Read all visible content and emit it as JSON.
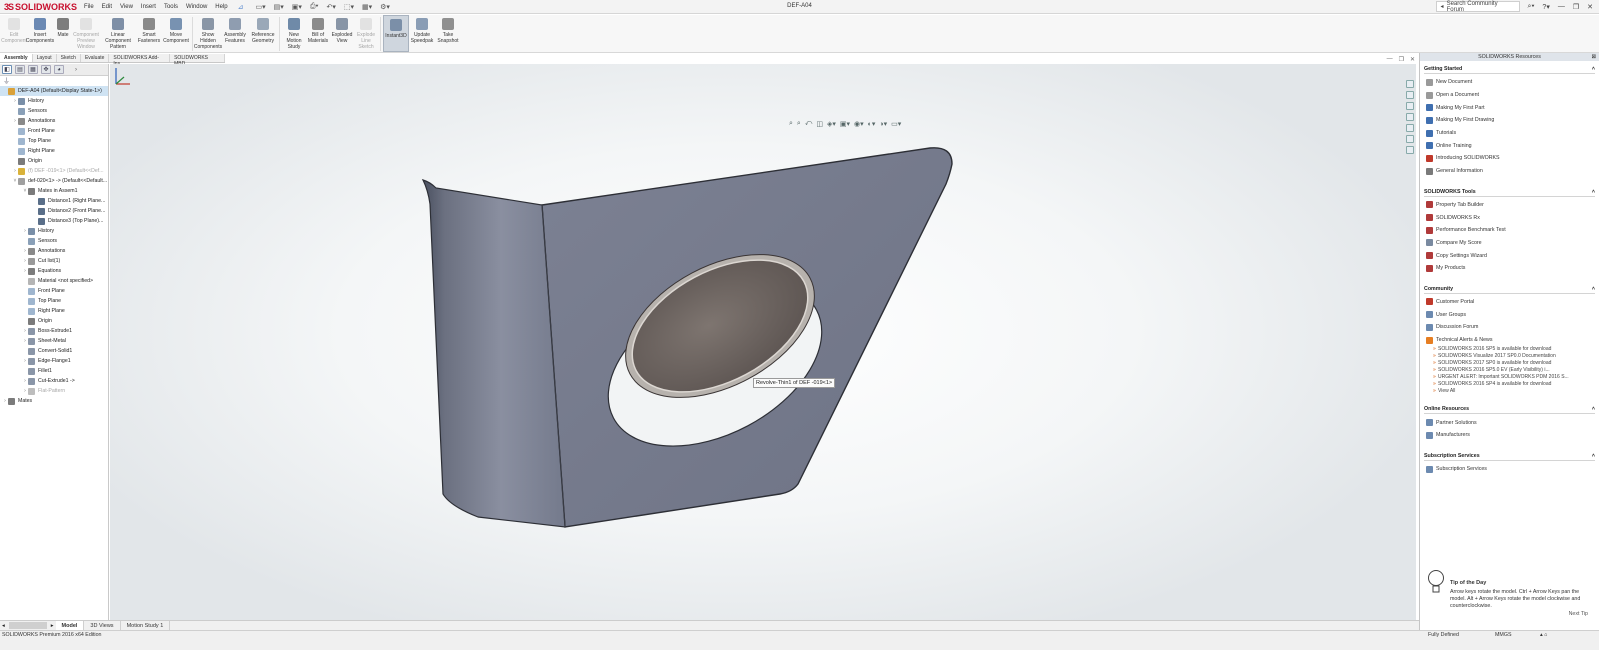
{
  "app": {
    "logo_text": "SOLIDWORKS",
    "document_title": "DEF-A04",
    "menus": [
      "File",
      "Edit",
      "View",
      "Insert",
      "Tools",
      "Window",
      "Help"
    ],
    "search_placeholder": "Search Community Forum"
  },
  "ribbon": {
    "buttons": [
      {
        "label": "Edit Component",
        "disabled": true,
        "icon": "edit-component-icon",
        "color": "#b9b9b9"
      },
      {
        "label": "Insert Components",
        "disabled": false,
        "icon": "insert-components-icon",
        "color": "#6b89b3"
      },
      {
        "label": "Mate",
        "disabled": false,
        "icon": "mate-icon",
        "color": "#7d7d7d"
      },
      {
        "label": "Component Preview Window",
        "disabled": true,
        "icon": "component-preview-icon",
        "color": "#b9b9b9"
      },
      {
        "label": "Linear Component Pattern",
        "disabled": false,
        "icon": "linear-pattern-icon",
        "color": "#7e8fa6"
      },
      {
        "label": "Smart Fasteners",
        "disabled": false,
        "icon": "smart-fasteners-icon",
        "color": "#8a8a8a"
      },
      {
        "label": "Move Component",
        "disabled": false,
        "icon": "move-component-icon",
        "color": "#7892b1"
      },
      {
        "label": "Show Hidden Components",
        "disabled": false,
        "icon": "show-hidden-icon",
        "color": "#8a96a6"
      },
      {
        "label": "Assembly Features",
        "disabled": false,
        "icon": "assembly-features-icon",
        "color": "#8f9db0"
      },
      {
        "label": "Reference Geometry",
        "disabled": false,
        "icon": "reference-geometry-icon",
        "color": "#9aa8b8"
      },
      {
        "label": "New Motion Study",
        "disabled": false,
        "icon": "motion-study-icon",
        "color": "#6f8aa8"
      },
      {
        "label": "Bill of Materials",
        "disabled": false,
        "icon": "bill-of-materials-icon",
        "color": "#8b8b8b"
      },
      {
        "label": "Exploded View",
        "disabled": false,
        "icon": "exploded-view-icon",
        "color": "#8895a6"
      },
      {
        "label": "Explode Line Sketch",
        "disabled": true,
        "icon": "explode-line-icon",
        "color": "#b9b9b9"
      },
      {
        "label": "Instant3D",
        "disabled": false,
        "active": true,
        "icon": "instant3d-icon",
        "color": "#7b8fa8"
      },
      {
        "label": "Update Speedpak",
        "disabled": false,
        "icon": "speedpak-icon",
        "color": "#8a9db5"
      },
      {
        "label": "Take Snapshot",
        "disabled": false,
        "icon": "snapshot-icon",
        "color": "#909090"
      }
    ]
  },
  "command_tabs": [
    "Assembly",
    "Layout",
    "Sketch",
    "Evaluate",
    "SOLIDWORKS Add-Ins",
    "SOLIDWORKS MBD"
  ],
  "tree": [
    {
      "label": "DEF-A04  (Default<Display State-1>)",
      "indent": 0,
      "sel": true,
      "icon": "assembly-icon",
      "color": "#d9a13a",
      "expander": ""
    },
    {
      "label": "History",
      "indent": 1,
      "icon": "history-icon",
      "color": "#7a8fa8",
      "expander": "›"
    },
    {
      "label": "Sensors",
      "indent": 1,
      "icon": "sensor-icon",
      "color": "#8aa0b8",
      "expander": ""
    },
    {
      "label": "Annotations",
      "indent": 1,
      "icon": "annotations-icon",
      "color": "#8a8a8a",
      "expander": "›"
    },
    {
      "label": "Front Plane",
      "indent": 1,
      "icon": "plane-icon",
      "color": "#9fb6cf",
      "expander": ""
    },
    {
      "label": "Top Plane",
      "indent": 1,
      "icon": "plane-icon",
      "color": "#9fb6cf",
      "expander": ""
    },
    {
      "label": "Right Plane",
      "indent": 1,
      "icon": "plane-icon",
      "color": "#9fb6cf",
      "expander": ""
    },
    {
      "label": "Origin",
      "indent": 1,
      "icon": "origin-icon",
      "color": "#7b7b7b",
      "expander": ""
    },
    {
      "label": "(f) DEF -019<1> (Default<<Def...",
      "indent": 1,
      "icon": "part-icon",
      "color": "#d9b23a",
      "expander": "›",
      "dim": true
    },
    {
      "label": "def-020<1> -> (Default<<Default...",
      "indent": 1,
      "icon": "part-icon",
      "color": "#a0a0a0",
      "expander": "˅"
    },
    {
      "label": "Mates in Assem1",
      "indent": 2,
      "icon": "mates-icon",
      "color": "#7b7b7b",
      "expander": "˅"
    },
    {
      "label": "Distance1 (Right Plane...",
      "indent": 3,
      "icon": "distance-mate-icon",
      "color": "#5a6f89",
      "expander": ""
    },
    {
      "label": "Distance2 (Front Plane...",
      "indent": 3,
      "icon": "distance-mate-icon",
      "color": "#5a6f89",
      "expander": ""
    },
    {
      "label": "Distance3 (Top Plane)...",
      "indent": 3,
      "icon": "distance-mate-icon",
      "color": "#5a6f89",
      "expander": ""
    },
    {
      "label": "History",
      "indent": 2,
      "icon": "history-icon",
      "color": "#7a8fa8",
      "expander": "›"
    },
    {
      "label": "Sensors",
      "indent": 2,
      "icon": "sensor-icon",
      "color": "#8aa0b8",
      "expander": ""
    },
    {
      "label": "Annotations",
      "indent": 2,
      "icon": "annotations-icon",
      "color": "#8a8a8a",
      "expander": "›"
    },
    {
      "label": "Cut list(1)",
      "indent": 2,
      "icon": "cut-list-icon",
      "color": "#9a9a9a",
      "expander": "›"
    },
    {
      "label": "Equations",
      "indent": 2,
      "icon": "equations-icon",
      "color": "#7d7d7d",
      "expander": "›"
    },
    {
      "label": "Material <not specified>",
      "indent": 2,
      "icon": "material-icon",
      "color": "#b5b5b5",
      "expander": ""
    },
    {
      "label": "Front Plane",
      "indent": 2,
      "icon": "plane-icon",
      "color": "#9fb6cf",
      "expander": ""
    },
    {
      "label": "Top Plane",
      "indent": 2,
      "icon": "plane-icon",
      "color": "#9fb6cf",
      "expander": ""
    },
    {
      "label": "Right Plane",
      "indent": 2,
      "icon": "plane-icon",
      "color": "#9fb6cf",
      "expander": ""
    },
    {
      "label": "Origin",
      "indent": 2,
      "icon": "origin-icon",
      "color": "#7b7b7b",
      "expander": ""
    },
    {
      "label": "Boss-Extrude1",
      "indent": 2,
      "icon": "extrude-icon",
      "color": "#8a96a8",
      "expander": "›"
    },
    {
      "label": "Sheet-Metal",
      "indent": 2,
      "icon": "sheet-metal-icon",
      "color": "#8a96a8",
      "expander": "›"
    },
    {
      "label": "Convert-Solid1",
      "indent": 2,
      "icon": "convert-solid-icon",
      "color": "#8a96a8",
      "expander": ""
    },
    {
      "label": "Edge-Flange1",
      "indent": 2,
      "icon": "edge-flange-icon",
      "color": "#8a96a8",
      "expander": "›"
    },
    {
      "label": "Fillet1",
      "indent": 2,
      "icon": "fillet-icon",
      "color": "#8a96a8",
      "expander": ""
    },
    {
      "label": "Cut-Extrude1 ->",
      "indent": 2,
      "icon": "cut-extrude-icon",
      "color": "#8a96a8",
      "expander": "›"
    },
    {
      "label": "Flat-Pattern",
      "indent": 2,
      "icon": "flat-pattern-icon",
      "color": "#bdbdbd",
      "expander": "›",
      "dim": true
    },
    {
      "label": "Mates",
      "indent": 0,
      "icon": "mates-icon",
      "color": "#7b7b7b",
      "expander": "›"
    }
  ],
  "viewport": {
    "tooltip": "Revolve-Thin1 of DEF -019<1>"
  },
  "resources": {
    "title": "SOLIDWORKS Resources",
    "sections": [
      {
        "title": "Getting Started",
        "items": [
          {
            "label": "New Document",
            "icon": "new-document-icon",
            "color": "#9a9a9a"
          },
          {
            "label": "Open a Document",
            "icon": "open-document-icon",
            "color": "#9a9a9a"
          },
          {
            "label": "Making My First Part",
            "icon": "first-part-icon",
            "color": "#3f6fb0"
          },
          {
            "label": "Making My First Drawing",
            "icon": "first-drawing-icon",
            "color": "#3f6fb0"
          },
          {
            "label": "Tutorials",
            "icon": "tutorials-icon",
            "color": "#3f6fb0"
          },
          {
            "label": "Online Training",
            "icon": "online-training-icon",
            "color": "#3f6fb0"
          },
          {
            "label": "Introducing SOLIDWORKS",
            "icon": "introducing-icon",
            "color": "#c0392b"
          },
          {
            "label": "General Information",
            "icon": "info-icon",
            "color": "#7a7a7a"
          }
        ]
      },
      {
        "title": "SOLIDWORKS Tools",
        "items": [
          {
            "label": "Property Tab Builder",
            "icon": "property-tab-icon",
            "color": "#b03a3a"
          },
          {
            "label": "SOLIDWORKS Rx",
            "icon": "rx-icon",
            "color": "#b03a3a"
          },
          {
            "label": "Performance Benchmark Test",
            "icon": "benchmark-icon",
            "color": "#b03a3a"
          },
          {
            "label": "Compare My Score",
            "icon": "compare-score-icon",
            "color": "#7a8aa0"
          },
          {
            "label": "Copy Settings Wizard",
            "icon": "copy-settings-icon",
            "color": "#b03a3a"
          },
          {
            "label": "My Products",
            "icon": "products-icon",
            "color": "#b03a3a"
          }
        ]
      },
      {
        "title": "Community",
        "items": [
          {
            "label": "Customer Portal",
            "icon": "customer-portal-icon",
            "color": "#c0392b"
          },
          {
            "label": "User Groups",
            "icon": "user-groups-icon",
            "color": "#6c8ab0"
          },
          {
            "label": "Discussion Forum",
            "icon": "forum-icon",
            "color": "#6c8ab0"
          },
          {
            "label": "Technical Alerts & News",
            "icon": "rss-icon",
            "color": "#e67e22"
          }
        ],
        "news": [
          "SOLIDWORKS 2016 SP5 is available for download",
          "SOLIDWORKS Visualize 2017 SP0.0 Documentation",
          "SOLIDWORKS 2017 SP0 is available for download",
          "SOLIDWORKS 2016 SP5.0 EV (Early Visibility) i...",
          "URGENT ALERT: Important SOLIDWORKS PDM 2016 S...",
          "SOLIDWORKS 2016 SP4 is available for download",
          "View All"
        ]
      },
      {
        "title": "Online Resources",
        "items": [
          {
            "label": "Partner Solutions",
            "icon": "partner-icon",
            "color": "#6c8ab0"
          },
          {
            "label": "Manufacturers",
            "icon": "manufacturers-icon",
            "color": "#6c8ab0"
          }
        ]
      },
      {
        "title": "Subscription Services",
        "items": [
          {
            "label": "Subscription Services",
            "icon": "subscription-icon",
            "color": "#6c8ab0"
          }
        ]
      }
    ],
    "tip": {
      "title": "Tip of the Day",
      "text": "Arrow keys rotate the model. Ctrl + Arrow Keys pan the model. Alt + Arrow Keys rotate the model clockwise and counterclockwise.",
      "next": "Next Tip"
    }
  },
  "bottom_tabs": [
    "Model",
    "3D Views",
    "Motion Study 1"
  ],
  "status": {
    "edition": "SOLIDWORKS Premium 2016 x64 Edition",
    "state": "Fully Defined",
    "units": "MMGS"
  }
}
